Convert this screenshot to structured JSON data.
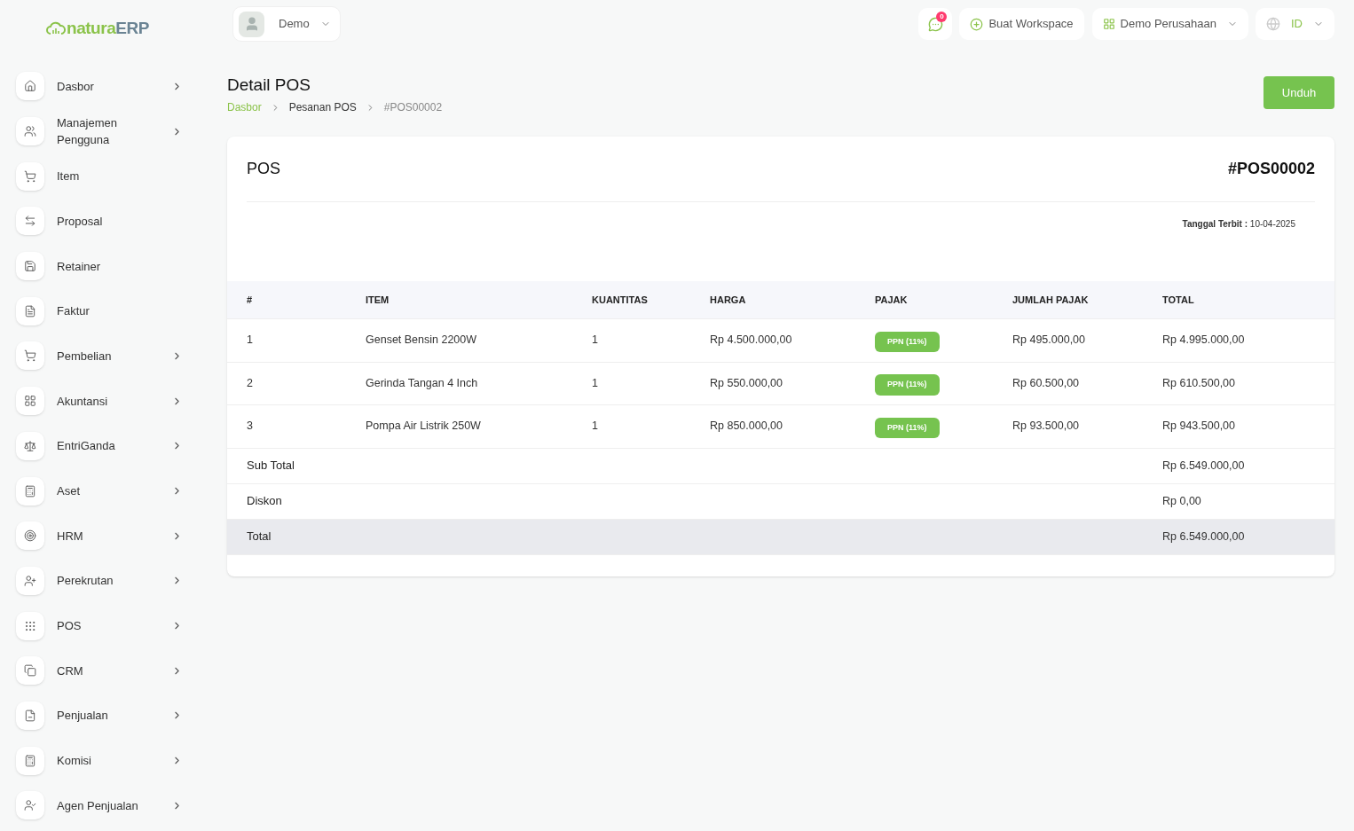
{
  "logo": {
    "brand": "natura",
    "suffix": "ERP"
  },
  "topbar": {
    "user": "Demo",
    "notifications": "0",
    "create_workspace": "Buat Workspace",
    "company": "Demo Perusahaan",
    "language": "ID"
  },
  "sidebar": {
    "items": [
      {
        "label": "Dasbor",
        "expandable": true
      },
      {
        "label": "Manajemen Pengguna",
        "expandable": true
      },
      {
        "label": "Item",
        "expandable": false
      },
      {
        "label": "Proposal",
        "expandable": false
      },
      {
        "label": "Retainer",
        "expandable": false
      },
      {
        "label": "Faktur",
        "expandable": false
      },
      {
        "label": "Pembelian",
        "expandable": true
      },
      {
        "label": "Akuntansi",
        "expandable": true
      },
      {
        "label": "EntriGanda",
        "expandable": true
      },
      {
        "label": "Aset",
        "expandable": true
      },
      {
        "label": "HRM",
        "expandable": true
      },
      {
        "label": "Perekrutan",
        "expandable": true
      },
      {
        "label": "POS",
        "expandable": true
      },
      {
        "label": "CRM",
        "expandable": true
      },
      {
        "label": "Penjualan",
        "expandable": true
      },
      {
        "label": "Komisi",
        "expandable": true
      },
      {
        "label": "Agen Penjualan",
        "expandable": true
      }
    ]
  },
  "page": {
    "title": "Detail POS",
    "breadcrumbs": [
      "Dasbor",
      "Pesanan POS",
      "#POS00002"
    ],
    "download_button": "Unduh"
  },
  "document": {
    "title": "POS",
    "number": "#POS00002",
    "issue_date": "**Tanggal Terbit :** 10-04-2025",
    "table": {
      "columns": [
        "#",
        "ITEM",
        "KUANTITAS",
        "HARGA",
        "PAJAK",
        "JUMLAH PAJAK",
        "TOTAL"
      ],
      "rows": [
        [
          "1",
          "Genset Bensin 2200W",
          "1",
          "Rp 4.500.000,00",
          "PPN (11%)",
          "Rp 495.000,00",
          "Rp 4.995.000,00"
        ],
        [
          "2",
          "Gerinda Tangan 4 Inch",
          "1",
          "Rp 550.000,00",
          "PPN (11%)",
          "Rp 60.500,00",
          "Rp 610.500,00"
        ],
        [
          "3",
          "Pompa Air Listrik 250W",
          "1",
          "Rp 850.000,00",
          "PPN (11%)",
          "Rp 93.500,00",
          "Rp 943.500,00"
        ]
      ]
    },
    "summary": [
      {
        "label": "Sub Total",
        "value": "Rp 6.549.000,00",
        "highlighted": false
      },
      {
        "label": "Diskon",
        "value": "Rp 0,00",
        "highlighted": false
      },
      {
        "label": "Total",
        "value": "Rp 6.549.000,00",
        "highlighted": true
      }
    ]
  }
}
